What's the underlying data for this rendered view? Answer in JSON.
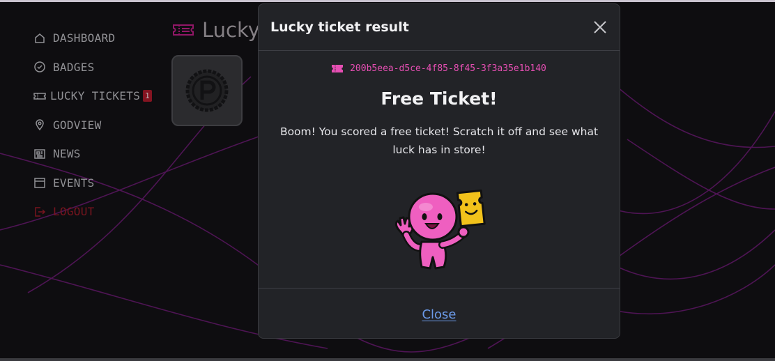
{
  "sidebar": {
    "items": [
      {
        "label": "DASHBOARD",
        "icon": "home-icon"
      },
      {
        "label": "BADGES",
        "icon": "badge-check-icon"
      },
      {
        "label": "LUCKY TICKETS",
        "icon": "ticket-icon",
        "badge": "1"
      },
      {
        "label": "GODVIEW",
        "icon": "map-pin-icon"
      },
      {
        "label": "NEWS",
        "icon": "newspaper-icon"
      },
      {
        "label": "EVENTS",
        "icon": "calendar-icon"
      },
      {
        "label": "LOGOUT",
        "icon": "logout-icon"
      }
    ]
  },
  "page": {
    "title_visible": "Lucky"
  },
  "modal": {
    "title": "Lucky ticket result",
    "ticket_id": "200b5eea-d5ce-4f85-8f45-3f3a35e1b140",
    "heading": "Free Ticket!",
    "description": "Boom! You scored a free ticket! Scratch it off and see what luck has in store!",
    "close_label": "Close"
  },
  "colors": {
    "accent_pink": "#e64fb3",
    "link_blue": "#6c9bea",
    "logout_red": "#a51d2a",
    "mascot_yellow": "#f2c21b"
  }
}
